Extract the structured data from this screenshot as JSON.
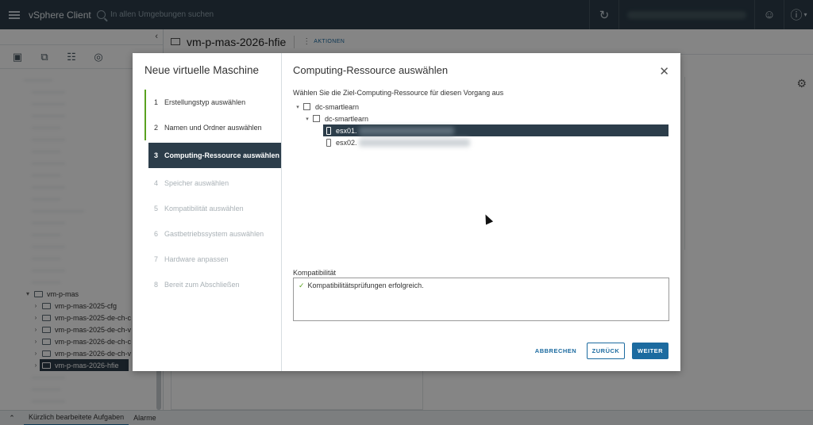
{
  "header": {
    "app_title": "vSphere Client",
    "search_placeholder": "In allen Umgebungen suchen"
  },
  "left_nav": {
    "tree_visible": [
      {
        "label": "vm-p-mas",
        "expanded": true
      },
      {
        "label": "vm-p-mas-2025-cfg"
      },
      {
        "label": "vm-p-mas-2025-de-ch-c"
      },
      {
        "label": "vm-p-mas-2025-de-ch-v"
      },
      {
        "label": "vm-p-mas-2026-de-ch-c"
      },
      {
        "label": "vm-p-mas-2026-de-ch-v"
      },
      {
        "label": "vm-p-mas-2026-hfie",
        "selected": true
      }
    ]
  },
  "main": {
    "object_name": "vm-p-mas-2026-hfie",
    "actions_label": "AKTIONEN"
  },
  "wizard": {
    "title": "Neue virtuelle Maschine",
    "steps": [
      {
        "num": "1",
        "label": "Erstellungstyp auswählen",
        "state": "done"
      },
      {
        "num": "2",
        "label": "Namen und Ordner auswählen",
        "state": "done"
      },
      {
        "num": "3",
        "label": "Computing-Ressource auswählen",
        "state": "active"
      },
      {
        "num": "4",
        "label": "Speicher auswählen",
        "state": "todo"
      },
      {
        "num": "5",
        "label": "Kompatibilität auswählen",
        "state": "todo"
      },
      {
        "num": "6",
        "label": "Gastbetriebssystem auswählen",
        "state": "todo"
      },
      {
        "num": "7",
        "label": "Hardware anpassen",
        "state": "todo"
      },
      {
        "num": "8",
        "label": "Bereit zum Abschließen",
        "state": "todo"
      }
    ],
    "page_title": "Computing-Ressource auswählen",
    "instruction": "Wählen Sie die Ziel-Computing-Ressource für diesen Vorgang aus",
    "resource_tree": {
      "datacenter": "dc-smartlearn",
      "cluster": "dc-smartlearn",
      "hosts": [
        "esx01.",
        "esx02."
      ]
    },
    "compatibility_label": "Kompatibilität",
    "compatibility_message": "Kompatibilitätsprüfungen erfolgreich.",
    "buttons": {
      "cancel": "ABBRECHEN",
      "back": "ZURÜCK",
      "next": "WEITER"
    }
  },
  "bottom_bar": {
    "recent_tasks": "Kürzlich bearbeitete Aufgaben",
    "alarms": "Alarme"
  },
  "colors": {
    "header_bg": "#2c3d4a",
    "accent": "#1c6ba0",
    "success": "#5aa220",
    "selection": "#2c3d4a"
  }
}
